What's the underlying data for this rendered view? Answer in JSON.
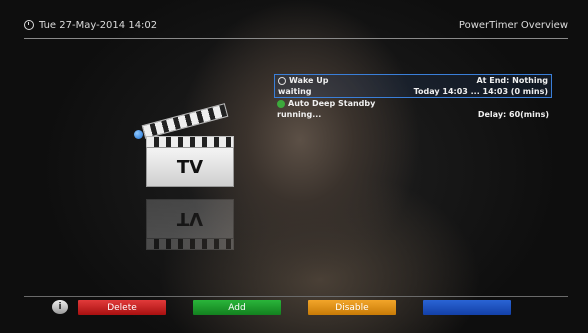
{
  "header": {
    "datetime": "Tue 27-May-2014 14:02",
    "title": "PowerTimer Overview"
  },
  "logo": {
    "label": "TV"
  },
  "timers": [
    {
      "name": "Wake Up",
      "action": "At End: Nothing",
      "status": "waiting",
      "time": "Today 14:03 ... 14:03 (0 mins)",
      "icon": "clock-icon",
      "selected": true
    },
    {
      "name": "Auto Deep Standby",
      "action": "",
      "status": "running...",
      "time": "Delay: 60(mins)",
      "icon": "power-icon",
      "selected": false
    }
  ],
  "buttons": {
    "red": "Delete",
    "green": "Add",
    "yellow": "Disable",
    "blue": ""
  },
  "colors": {
    "red": "#c41f1f",
    "green": "#1f9a2e",
    "yellow": "#e08f12",
    "blue": "#1d52c0",
    "selection": "#3a7fd9"
  }
}
